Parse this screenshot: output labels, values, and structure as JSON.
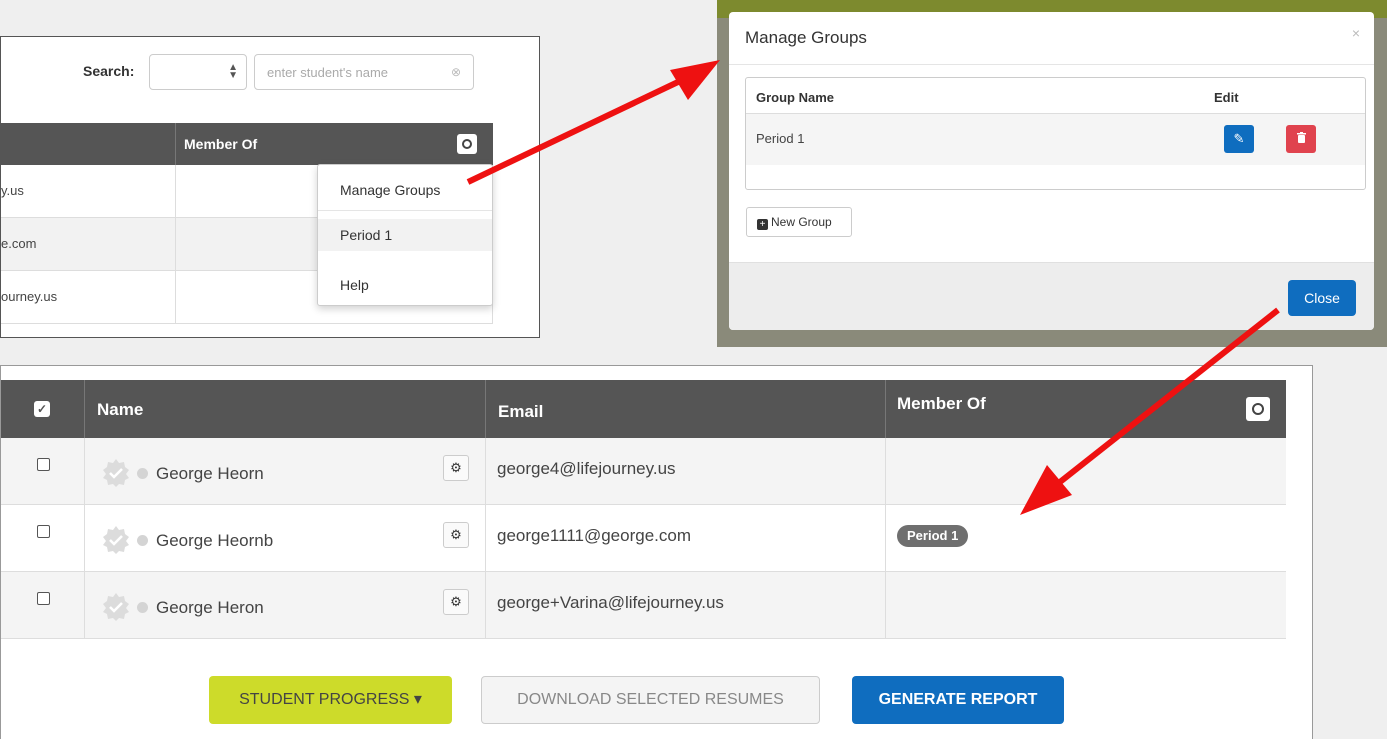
{
  "search_panel": {
    "search_label": "Search:",
    "search_placeholder": "enter student's name",
    "clear_icon": "⊗",
    "member_of_header": "Member Of",
    "rows": [
      {
        "email_fragment": "y.us"
      },
      {
        "email_fragment": "e.com"
      },
      {
        "email_fragment": "ourney.us"
      }
    ],
    "dropdown": {
      "items": [
        "Manage Groups",
        "Period 1",
        "Help"
      ]
    }
  },
  "manage_groups_modal": {
    "title": "Manage Groups",
    "close_x": "×",
    "col_group_name": "Group Name",
    "col_edit": "Edit",
    "groups": [
      {
        "name": "Period 1"
      }
    ],
    "new_group_label": "New Group",
    "close_button": "Close"
  },
  "student_table": {
    "headers": {
      "name": "Name",
      "email": "Email",
      "member_of": "Member Of"
    },
    "rows": [
      {
        "name": "George Heorn",
        "email": "george4@lifejourney.us",
        "group": ""
      },
      {
        "name": "George Heornb",
        "email": "george1111@george.com",
        "group": "Period 1"
      },
      {
        "name": "George Heron",
        "email": "george+Varina@lifejourney.us",
        "group": ""
      }
    ]
  },
  "actions": {
    "student_progress": "STUDENT PROGRESS ▾",
    "download_resumes": "DOWNLOAD SELECTED RESUMES",
    "generate_report": "GENERATE REPORT"
  },
  "colors": {
    "header_dark": "#555555",
    "primary_blue": "#0f6dbf",
    "danger_red": "#e0434e",
    "lime": "#cddb2a",
    "arrow_red": "#ee1111"
  },
  "icons": {
    "select_arrows": "up-down-arrows-icon",
    "add_column": "plus-circle-icon",
    "edit": "pencil-icon",
    "delete": "trash-icon",
    "new_group": "plus-square-icon",
    "row_settings": "gear-icon",
    "badge": "badge-check-icon"
  }
}
